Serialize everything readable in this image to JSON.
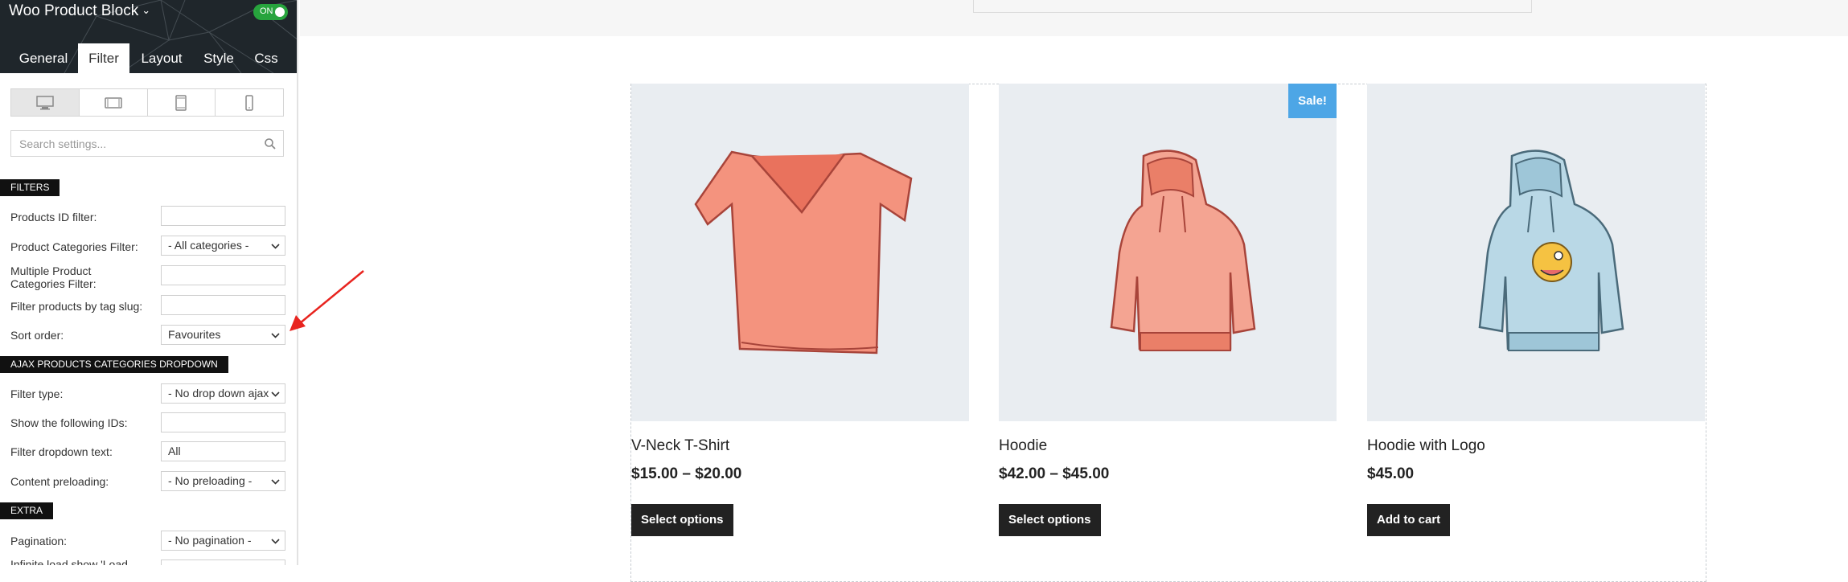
{
  "sidebar": {
    "title": "Woo Product Block",
    "toggle_label": "ON",
    "tabs": [
      {
        "label": "General"
      },
      {
        "label": "Filter"
      },
      {
        "label": "Layout"
      },
      {
        "label": "Style"
      },
      {
        "label": "Css"
      }
    ],
    "active_tab": "Filter",
    "devices": [
      "desktop-icon",
      "tablet-landscape-icon",
      "tablet-portrait-icon",
      "phone-icon"
    ],
    "search_placeholder": "Search settings...",
    "sections": {
      "filters": "FILTERS",
      "ajax": "AJAX PRODUCTS CATEGORIES DROPDOWN",
      "extra": "EXTRA"
    },
    "fields": {
      "products_id": {
        "label": "Products ID filter:",
        "value": ""
      },
      "categories": {
        "label": "Product Categories Filter:",
        "value": "- All categories -"
      },
      "multi_categories": {
        "label": "Multiple Product Categories Filter:",
        "value": ""
      },
      "tag_slug": {
        "label": "Filter products by tag slug:",
        "value": ""
      },
      "sort_order": {
        "label": "Sort order:",
        "value": "Favourites"
      },
      "filter_type": {
        "label": "Filter type:",
        "value": "- No drop down ajax filter -"
      },
      "show_ids": {
        "label": "Show the following IDs:",
        "value": ""
      },
      "dropdown_text": {
        "label": "Filter dropdown text:",
        "value": "All"
      },
      "preloading": {
        "label": "Content preloading:",
        "value": "- No preloading -"
      },
      "pagination": {
        "label": "Pagination:",
        "value": "- No pagination -"
      },
      "infinite_load": {
        "label": "Infinite load show 'Load",
        "value": ""
      }
    }
  },
  "products": [
    {
      "name": "V-Neck T-Shirt",
      "price": "$15.00 – $20.00",
      "button": "Select options",
      "sale": ""
    },
    {
      "name": "Hoodie",
      "price": "$42.00 – $45.00",
      "button": "Select options",
      "sale": "Sale!"
    },
    {
      "name": "Hoodie with Logo",
      "price": "$45.00",
      "button": "Add to cart",
      "sale": ""
    }
  ],
  "colors": {
    "sidebar_header": "#1f262b",
    "toggle_on": "#27a43d",
    "sale_badge": "#4da6e6",
    "annotation_arrow": "#e8241f",
    "product_bg": "#e9edf1"
  }
}
